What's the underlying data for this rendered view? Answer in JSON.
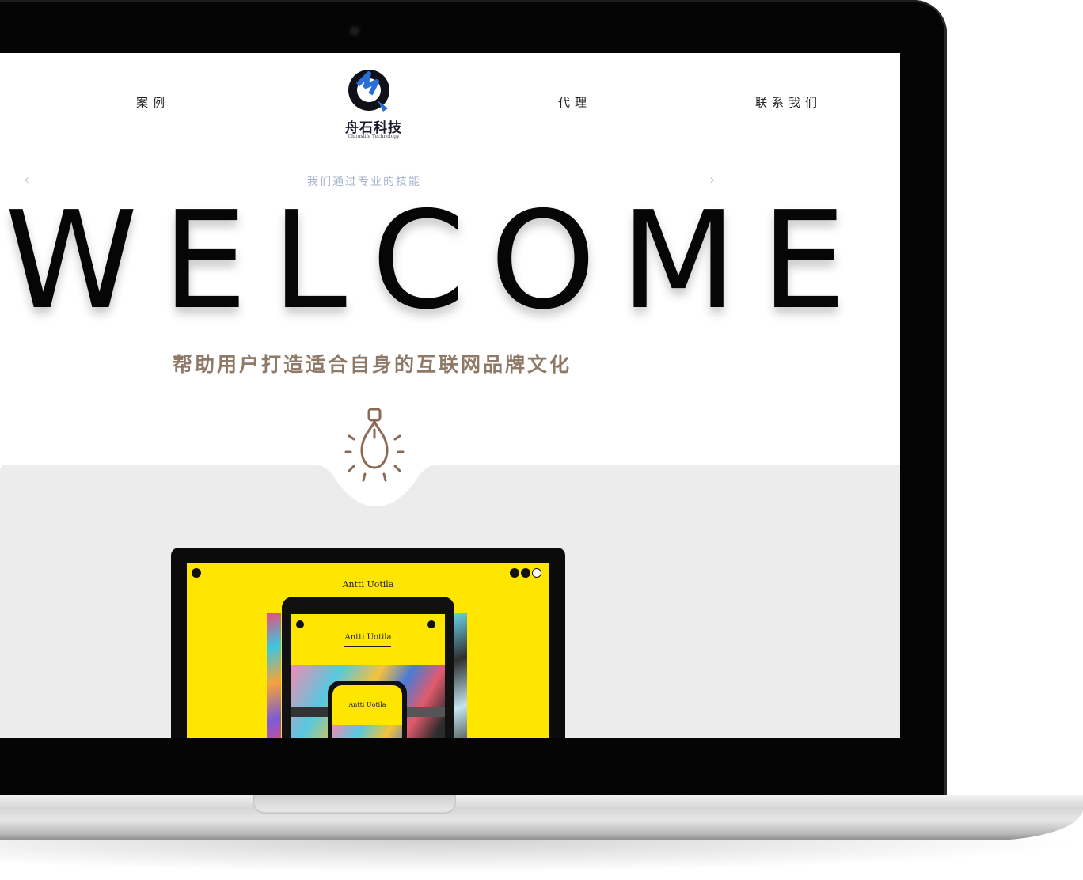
{
  "nav": {
    "items": [
      "案例",
      "代理",
      "联系我们"
    ]
  },
  "logo": {
    "name_cn": "舟石科技",
    "name_en": "Chouslife Technology"
  },
  "hero": {
    "subline": "我们通过专业的技能",
    "prev_arrow": "‹",
    "next_arrow": "›",
    "headline": "WELCOME",
    "tagline": "帮助用户打造适合自身的互联网品牌文化"
  },
  "showcase": {
    "laptop_title": "Antti Uotila",
    "tablet_title": "Antti Uotila",
    "phone_title": "Antti Uotila"
  },
  "colors": {
    "accent_brown": "#8f7a68",
    "showcase_yellow": "#ffe600",
    "section_gray": "#ececec",
    "logo_blue": "#2b6fd6"
  },
  "icons": [
    "bulb-icon",
    "logo-mark-icon",
    "chevron-left-icon",
    "chevron-right-icon"
  ]
}
